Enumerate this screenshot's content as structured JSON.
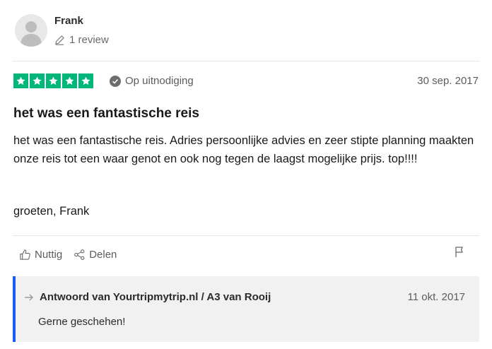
{
  "reviewer": {
    "name": "Frank",
    "review_count": "1 review"
  },
  "review": {
    "rating": 5,
    "star_color": "#00b67a",
    "verified_label": "Op uitnodiging",
    "date": "30 sep. 2017",
    "title": "het was een fantastische reis",
    "body": "het was een fantastische reis. Adries persoonlijke advies en zeer stipte planning maakten onze reis tot een waar genot en ook nog tegen de laagst mogelijke prijs. top!!!!",
    "greeting": "groeten, Frank"
  },
  "actions": {
    "useful_label": "Nuttig",
    "share_label": "Delen"
  },
  "reply": {
    "accent_color": "#1a5bff",
    "heading": "Antwoord van Yourtripmytrip.nl / A3 van Rooij",
    "date": "11 okt. 2017",
    "text": "Gerne geschehen!"
  }
}
